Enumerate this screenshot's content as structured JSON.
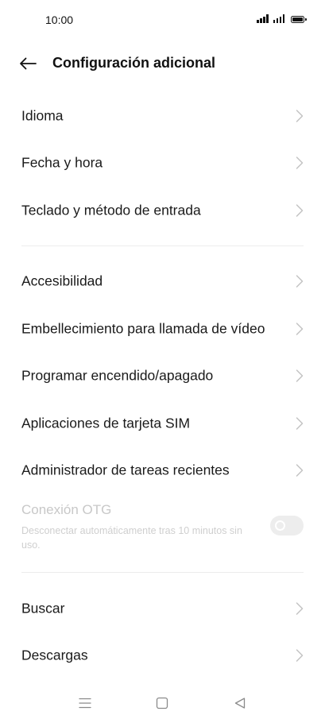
{
  "status_bar": {
    "time": "10:00"
  },
  "header": {
    "back_icon": "arrow-left-icon",
    "title": "Configuración adicional"
  },
  "group1": [
    {
      "label": "Idioma"
    },
    {
      "label": "Fecha y hora"
    },
    {
      "label": "Teclado y método de entrada"
    }
  ],
  "group2": [
    {
      "label": "Accesibilidad"
    },
    {
      "label": "Embellecimiento para llamada de vídeo"
    },
    {
      "label": "Programar encendido/apagado"
    },
    {
      "label": "Aplicaciones de tarjeta SIM"
    },
    {
      "label": "Administrador de tareas recientes"
    }
  ],
  "otg": {
    "title": "Conexión OTG",
    "subtitle": "Desconectar automáticamente tras 10 minutos sin uso.",
    "enabled": false,
    "disabled": true
  },
  "group3": [
    {
      "label": "Buscar"
    },
    {
      "label": "Descargas"
    }
  ],
  "nav_bar": {
    "icons": [
      "menu-icon",
      "home-icon",
      "back-triangle-icon"
    ]
  },
  "colors": {
    "text": "#1a1a1a",
    "chevron": "#c4c4c4",
    "disabled_text": "#c8c8c8",
    "divider": "#ececec",
    "background": "#ffffff"
  }
}
